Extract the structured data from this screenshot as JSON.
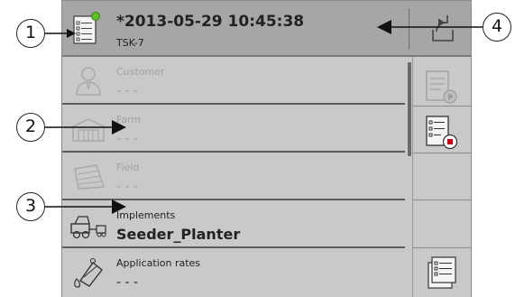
{
  "header": {
    "task_name": "*2013-05-29 10:45:38",
    "task_id": "TSK-7"
  },
  "rows": [
    {
      "label": "Customer",
      "value": "- - -"
    },
    {
      "label": "Farm",
      "value": "- - -"
    },
    {
      "label": "Field",
      "value": "- - -"
    },
    {
      "label": "Implements",
      "value": "Seeder_Planter"
    },
    {
      "label": "Application rates",
      "value": "- - -"
    }
  ],
  "callouts": [
    "1",
    "2",
    "3",
    "4"
  ],
  "icons": {
    "header": "task-document-icon",
    "back": "back-arrow-icon",
    "start": "task-start-icon",
    "stop": "task-stop-icon",
    "tasklist": "task-list-icon"
  },
  "colors": {
    "background": "#c9c9c9",
    "header": "#a6a6a6",
    "status_dot": "#5fbf2a",
    "stop": "#c00018"
  }
}
